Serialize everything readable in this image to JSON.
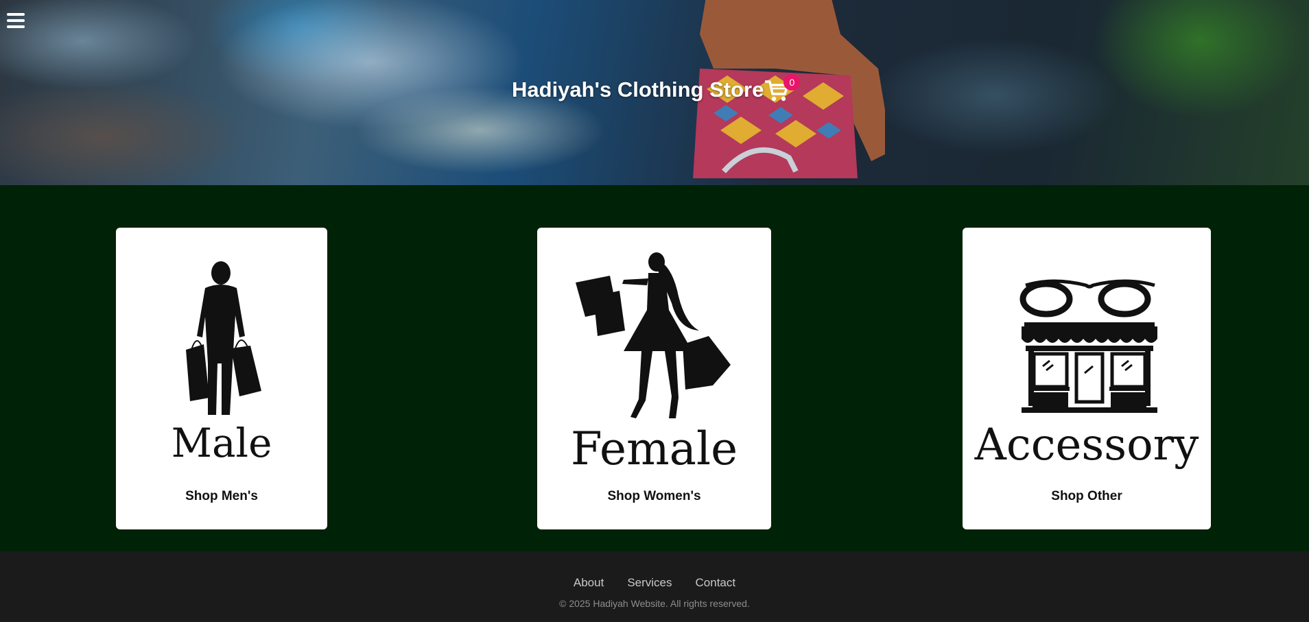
{
  "header": {
    "menu_icon": "hamburger-menu-icon",
    "title": "Hadiyah's Clothing Store",
    "cart_icon": "shopping-cart-icon",
    "cart_count": "0",
    "badge_color": "#e8156a"
  },
  "main": {
    "background_color": "#002207",
    "cards": [
      {
        "image_word": "Male",
        "image_icon": "man-with-shopping-bags-icon",
        "cta": "Shop Men's"
      },
      {
        "image_word": "Female",
        "image_icon": "woman-with-shopping-bags-icon",
        "cta": "Shop Women's"
      },
      {
        "image_word": "Accessory",
        "image_icon": "storefront-with-glasses-icon",
        "cta": "Shop Other"
      }
    ]
  },
  "footer": {
    "links": [
      "About",
      "Services",
      "Contact"
    ],
    "copyright": "© 2025 Hadiyah Website. All rights reserved."
  }
}
